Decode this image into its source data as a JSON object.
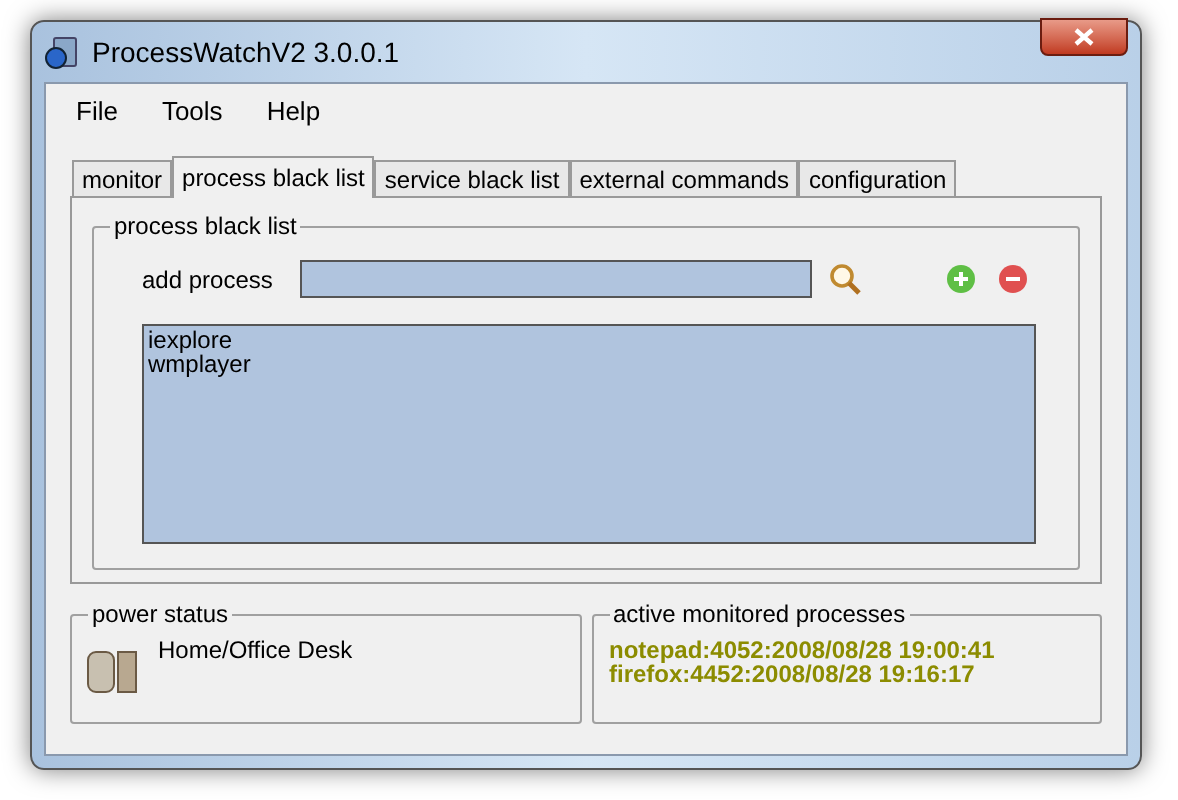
{
  "window": {
    "title": "ProcessWatchV2 3.0.0.1"
  },
  "menu": [
    "File",
    "Tools",
    "Help"
  ],
  "tabs": [
    {
      "label": "monitor",
      "selected": false
    },
    {
      "label": "process black list",
      "selected": true
    },
    {
      "label": "service black list",
      "selected": false
    },
    {
      "label": "external commands",
      "selected": false
    },
    {
      "label": "configuration",
      "selected": false
    }
  ],
  "process_black_list": {
    "title": "process black list",
    "add_label": "add process",
    "items": [
      "iexplore",
      "wmplayer"
    ]
  },
  "power_status": {
    "title": "power status",
    "value": "Home/Office Desk"
  },
  "active_processes": {
    "title": "active monitored processes",
    "items": [
      "notepad:4052:2008/08/28 19:00:41",
      "firefox:4452:2008/08/28 19:16:17"
    ]
  }
}
